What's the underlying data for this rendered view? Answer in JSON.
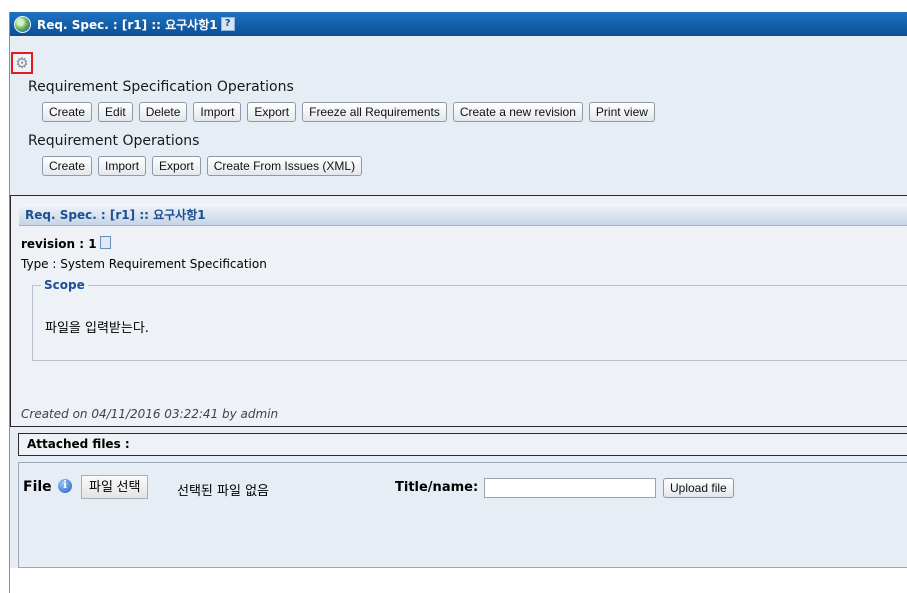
{
  "window": {
    "title": "Req. Spec. : [r1] :: 요구사항1",
    "help_glyph": "?"
  },
  "req_spec_ops": {
    "title": "Requirement Specification Operations",
    "buttons": [
      "Create",
      "Edit",
      "Delete",
      "Import",
      "Export",
      "Freeze all Requirements",
      "Create a new revision",
      "Print view"
    ]
  },
  "req_ops": {
    "title": "Requirement Operations",
    "buttons": [
      "Create",
      "Import",
      "Export",
      "Create From Issues (XML)"
    ]
  },
  "spec": {
    "header": "Req. Spec. : [r1] :: 요구사항1",
    "revision_label": "revision : 1",
    "type_label": "Type : System Requirement Specification",
    "scope_legend": "Scope",
    "scope_text": "파일을 입력받는다.",
    "created": "Created on 04/11/2016 03:22:41  by admin"
  },
  "attachments": {
    "header": "Attached files :",
    "file_label": "File",
    "choose_button": "파일 선택",
    "no_file_text": "선택된 파일 없음",
    "title_label": "Title/name:",
    "title_value": "",
    "upload_button": "Upload file"
  },
  "colors": {
    "titlebar": "#0b4f95",
    "panel": "#e6edf5",
    "highlight_border": "#e01c1c",
    "header_text": "#1c4f93"
  },
  "icons": [
    "globe-icon",
    "help-icon",
    "gear-icon",
    "document-icon",
    "info-icon"
  ]
}
